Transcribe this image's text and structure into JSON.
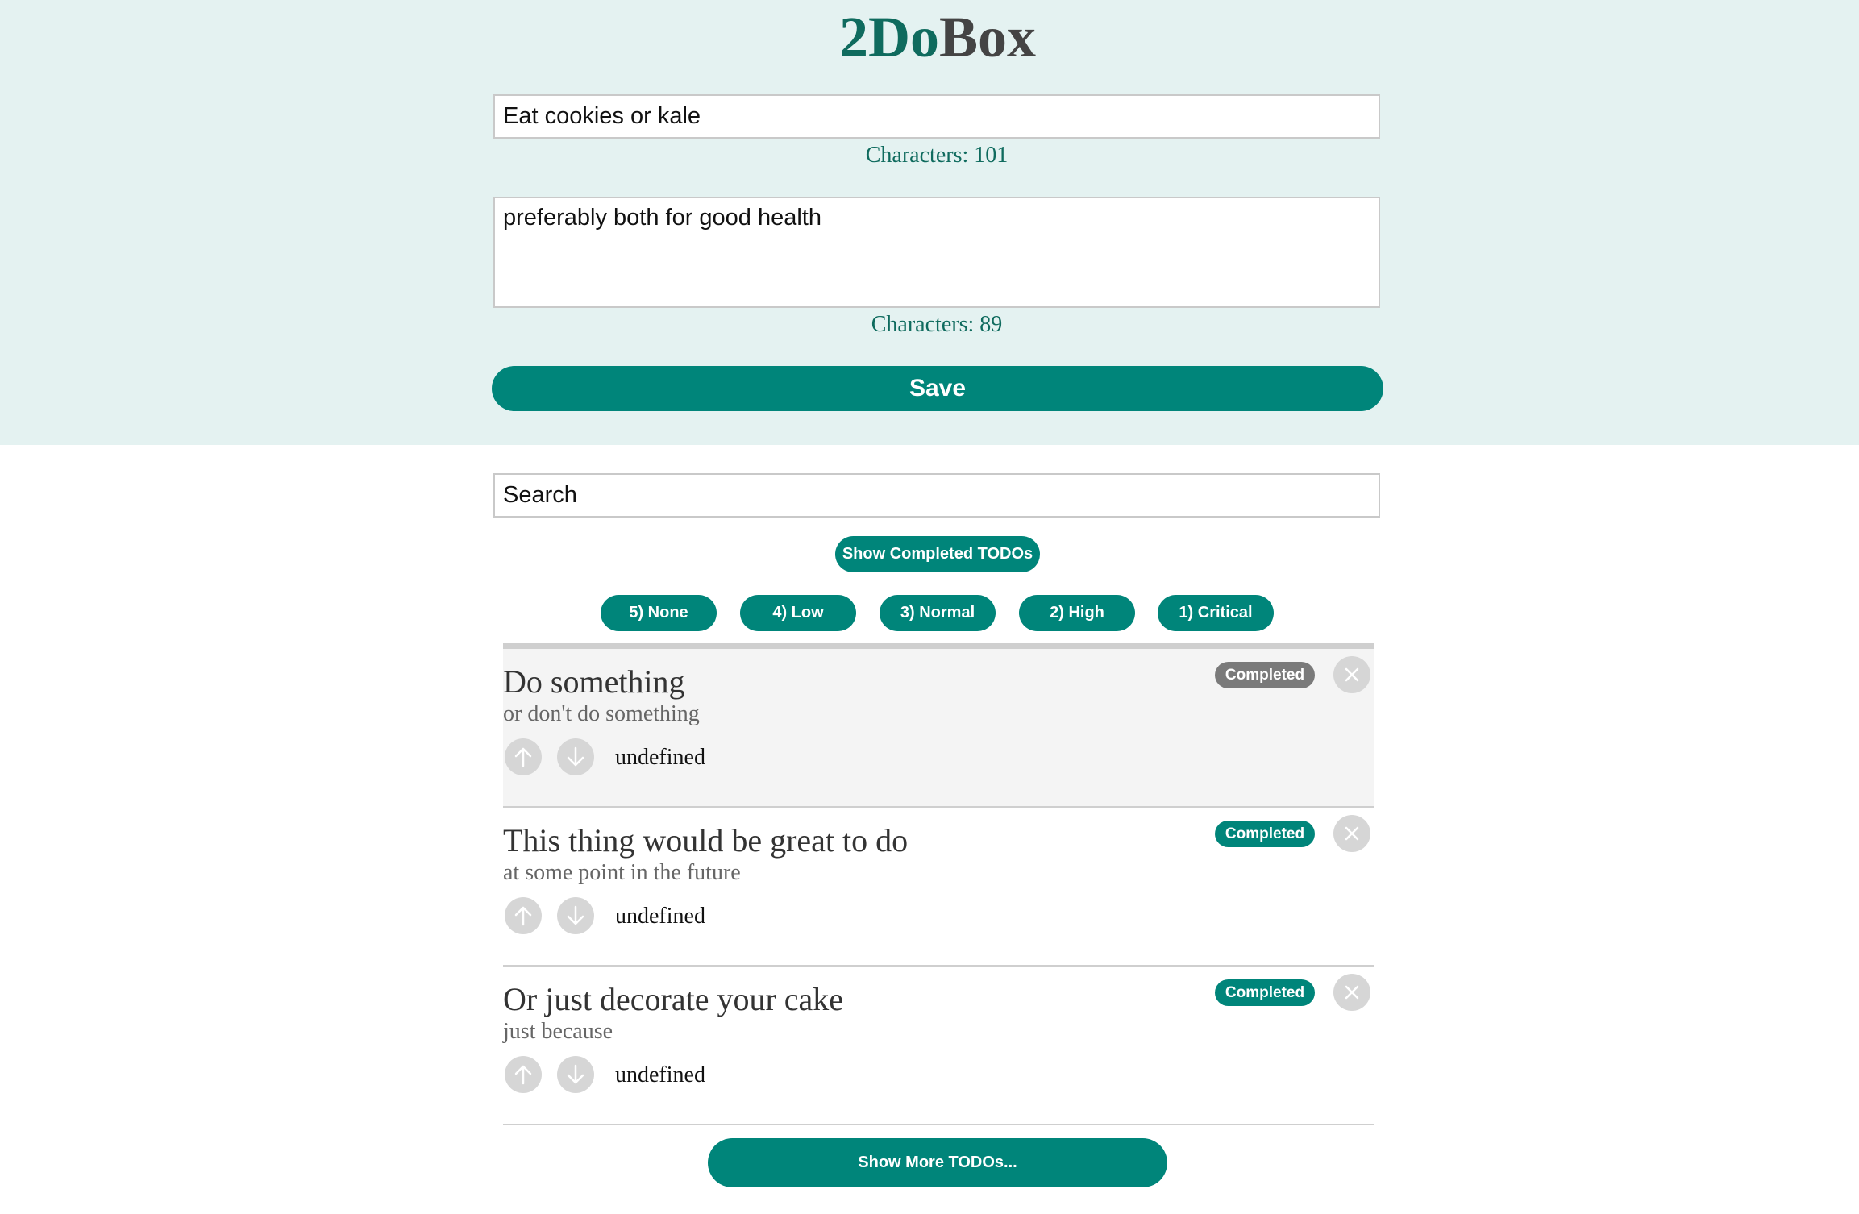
{
  "app": {
    "title_part_a": "2Do",
    "title_part_b": "Box"
  },
  "form": {
    "title_value": "Eat cookies or kale",
    "title_char_count": "Characters: 101",
    "body_value": "preferably both for good health",
    "body_char_count": "Characters: 89",
    "save_label": "Save"
  },
  "search": {
    "placeholder": "Search",
    "value": ""
  },
  "filters": {
    "show_completed_label": "Show Completed TODOs",
    "priorities": [
      "5) None",
      "4) Low",
      "3) Normal",
      "2) High",
      "1) Critical"
    ]
  },
  "todos": [
    {
      "title": "Do something",
      "body": "or don't do something",
      "importance": "undefined",
      "status_label": "Completed",
      "completed": true
    },
    {
      "title": "This thing would be great to do",
      "body": "at some point in the future",
      "importance": "undefined",
      "status_label": "Completed",
      "completed": false
    },
    {
      "title": "Or just decorate your cake",
      "body": "just because",
      "importance": "undefined",
      "status_label": "Completed",
      "completed": false
    }
  ],
  "icons": {
    "upvote": "arrow-up-icon",
    "downvote": "arrow-down-icon",
    "delete": "close-icon"
  },
  "colors": {
    "accent": "#00857a",
    "title_green": "#0f6b5e",
    "header_bg": "#e4f2f1",
    "completed_pill_done": "#7a7a7a",
    "icon_circle": "#d6d6d6"
  },
  "list_footer": {
    "show_more_label": "Show More TODOs..."
  }
}
